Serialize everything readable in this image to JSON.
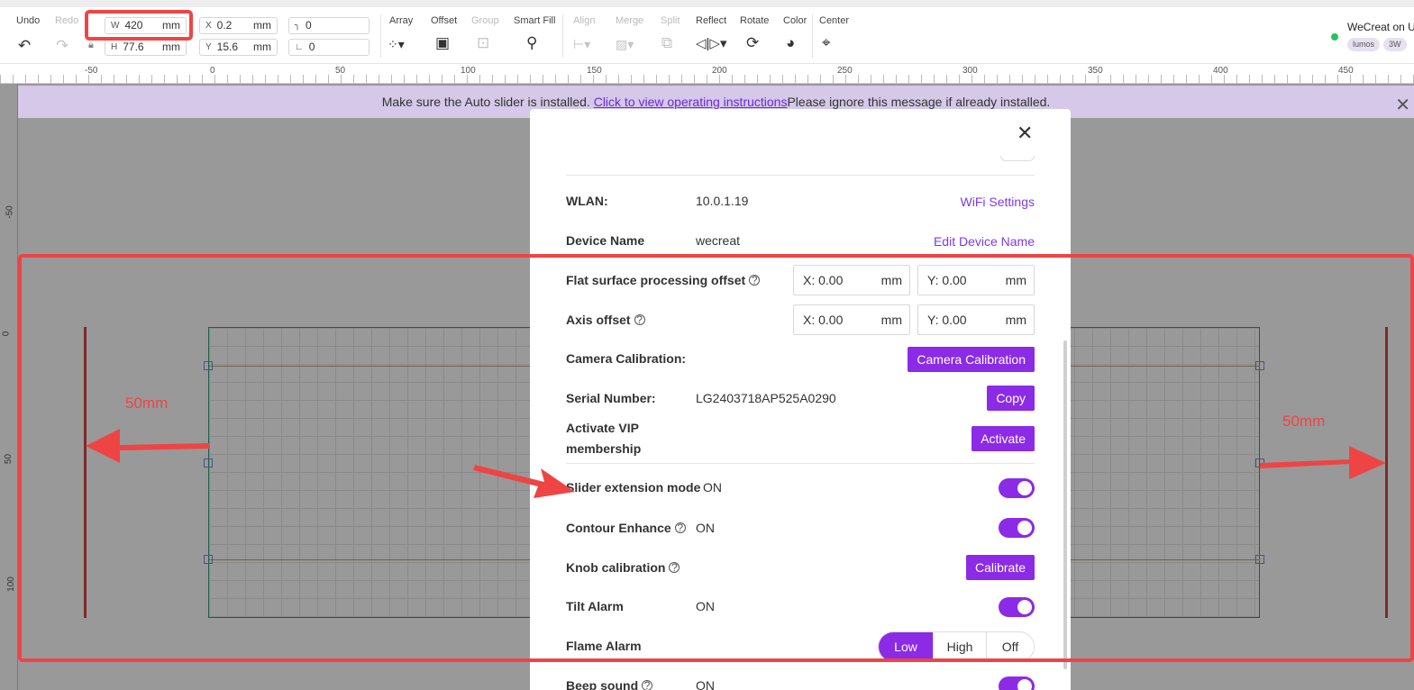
{
  "toolbar": {
    "undo": "Undo",
    "redo": "Redo",
    "w_prefix": "W",
    "w_value": "420",
    "w_unit": "mm",
    "h_prefix": "H",
    "h_value": "77.6",
    "h_unit": "mm",
    "x_prefix": "X",
    "x_value": "0.2",
    "x_unit": "mm",
    "y_prefix": "Y",
    "y_value": "15.6",
    "y_unit": "mm",
    "corner_value": "0",
    "angle_value": "0",
    "array": "Array",
    "offset": "Offset",
    "group": "Group",
    "smart_fill": "Smart Fill",
    "align": "Align",
    "merge": "Merge",
    "split": "Split",
    "reflect": "Reflect",
    "rotate": "Rotate",
    "color": "Color",
    "center": "Center"
  },
  "device": {
    "name": "WeCreat on U",
    "tag1": "lumos",
    "tag2": "3W",
    "status_color": "#22c55e"
  },
  "ruler": {
    "h_labels": [
      "-50",
      "0",
      "50",
      "100",
      "150",
      "200",
      "250",
      "300",
      "350",
      "400",
      "450"
    ],
    "v_labels": [
      "-50",
      "0",
      "50",
      "100"
    ]
  },
  "banner": {
    "text_before": "Make sure the Auto slider is installed. ",
    "link": "Click to view operating instructions",
    "text_after": "Please ignore this message if already installed.",
    "close": "✕"
  },
  "modal": {
    "close": "✕",
    "wlan_label": "WLAN:",
    "wlan_value": "10.0.1.19",
    "wifi_settings": "WiFi Settings",
    "device_name_label": "Device Name",
    "device_name_value": "wecreat",
    "edit_device_name": "Edit Device Name",
    "flat_offset_label": "Flat surface processing offset",
    "flat_x": "X: 0.00",
    "flat_y": "Y: 0.00",
    "axis_offset_label": "Axis offset",
    "axis_x": "X: 0.00",
    "axis_y": "Y: 0.00",
    "unit": "mm",
    "camera_label": "Camera Calibration:",
    "camera_button": "Camera Calibration",
    "serial_label": "Serial Number:",
    "serial_value": "LG2403718AP525A0290",
    "copy_button": "Copy",
    "vip_label_1": "Activate VIP",
    "vip_label_2": "membership",
    "activate_button": "Activate",
    "slider_label": "Slider extension mode",
    "slider_state": "ON",
    "contour_label": "Contour Enhance",
    "contour_state": "ON",
    "knob_label": "Knob calibration",
    "calibrate_button": "Calibrate",
    "tilt_label": "Tilt Alarm",
    "tilt_state": "ON",
    "flame_label": "Flame Alarm",
    "flame_options": [
      "Low",
      "High",
      "Off"
    ],
    "flame_selected": "Low",
    "beep_label": "Beep sound",
    "beep_state": "ON"
  },
  "annotations": {
    "left": "50mm",
    "right": "50mm",
    "color": "#ef4444"
  },
  "colors": {
    "accent": "#8b2be6",
    "link": "#7c3aed",
    "banner": "#d5c8e8"
  }
}
